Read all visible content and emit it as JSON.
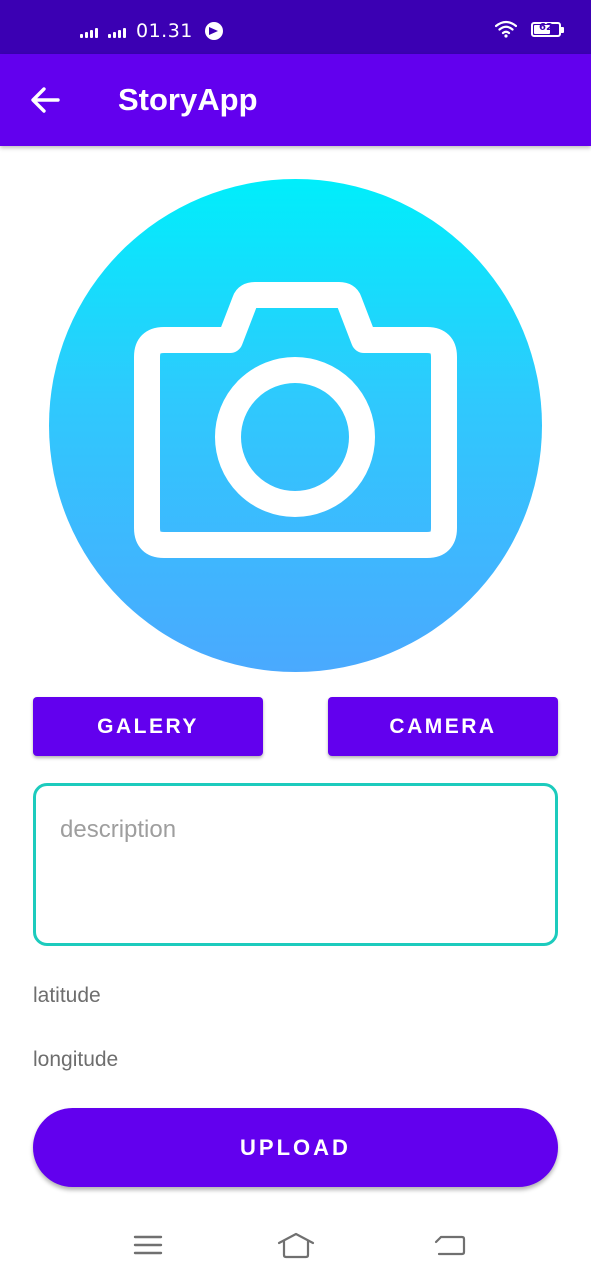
{
  "status_bar": {
    "time": "01.31",
    "battery_level": "62",
    "icons": [
      "signal-icon",
      "signal-icon",
      "telegram-icon",
      "wifi-icon",
      "battery-icon"
    ]
  },
  "app_bar": {
    "title": "StoryApp",
    "back_icon": "arrow-left-icon"
  },
  "preview": {
    "icon": "camera-icon"
  },
  "actions": {
    "gallery_label": "GALERY",
    "camera_label": "CAMERA"
  },
  "form": {
    "description_placeholder": "description",
    "description_value": "",
    "latitude_label": "latitude",
    "longitude_label": "longitude",
    "upload_label": "UPLOAD"
  },
  "nav": {
    "icons": [
      "menu-icon",
      "home-icon",
      "back-icon"
    ]
  },
  "colors": {
    "status_bar": "#3b00b3",
    "primary": "#6200ee",
    "input_border": "#1ccbbd",
    "gradient_top": "#00eefb",
    "gradient_bottom": "#4aa9fe"
  }
}
